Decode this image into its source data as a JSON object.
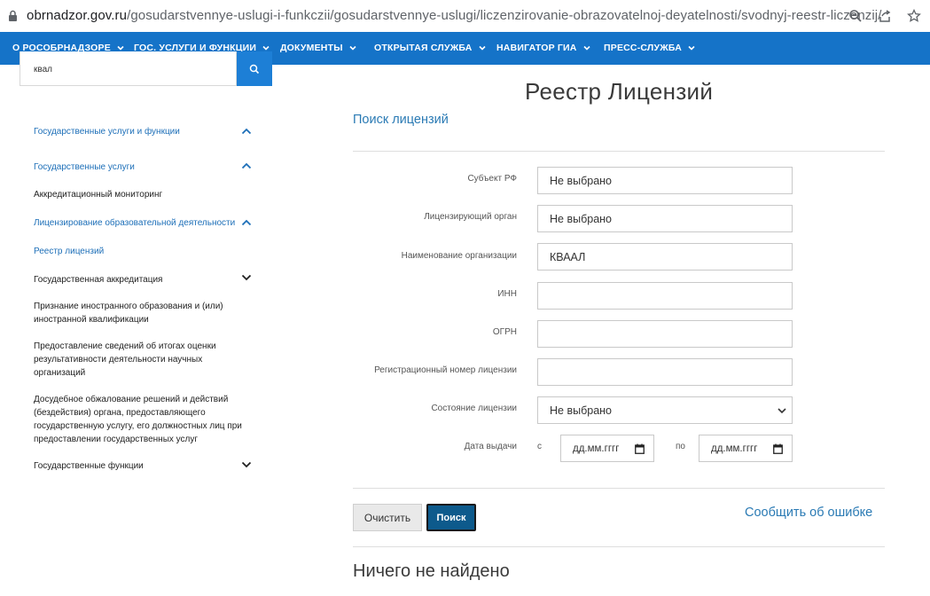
{
  "browser": {
    "url_host": "obrnadzor.gov.ru",
    "url_path": "/gosudarstvennye-uslugi-i-funkczii/gosudarstvennye-uslugi/liczenzirovanie-obrazovatelnoj-deyatelnosti/svodnyj-reestr-liczenzij/",
    "icons": [
      "lock-icon",
      "zoom-icon",
      "share-icon",
      "bookmark-star-icon"
    ]
  },
  "nav": {
    "items": [
      {
        "label": "О РОСОБРНАДЗОРЕ"
      },
      {
        "label": "ГОС. УСЛУГИ И ФУНКЦИИ"
      },
      {
        "label": "ДОКУМЕНТЫ"
      },
      {
        "label": "ОТКРЫТАЯ СЛУЖБА"
      },
      {
        "label": "НАВИГАТОР ГИА"
      },
      {
        "label": "ПРЕСС-СЛУЖБА"
      }
    ],
    "color": "#1573c8"
  },
  "search": {
    "value": "квал"
  },
  "sidebar": {
    "items": [
      {
        "label": "Государственные услуги и функции"
      },
      {
        "label": "Государственные услуги"
      },
      {
        "label": "Аккредитационный мониторинг"
      },
      {
        "label": "Лицензирование образовательной деятельности"
      },
      {
        "label": "Реестр лицензий"
      },
      {
        "label": "Государственная аккредитация"
      },
      {
        "label": "Признание иностранного образования и (или) иностранной квалификации"
      },
      {
        "label": "Предоставление сведений об итогах оценки результативности деятельности научных организаций"
      },
      {
        "label": "Досудебное обжалование решений и действий (бездействия) органа, предоставляющего государственную услугу, его должностных лиц при предоставлении государственных услуг"
      },
      {
        "label": "Государственные функции"
      }
    ]
  },
  "main": {
    "title": "Реестр Лицензий",
    "search_link": "Поиск лицензий",
    "form": {
      "subject_label": "Субъект РФ",
      "subject_value": "Не выбрано",
      "authority_label": "Лицензирующий орган",
      "authority_value": "Не выбрано",
      "org_label": "Наименование организации",
      "org_value": "КВААЛ",
      "inn_label": "ИНН",
      "inn_value": "",
      "ogrn_label": "ОГРН",
      "ogrn_value": "",
      "regnum_label": "Регистрационный номер лицензии",
      "regnum_value": "",
      "status_label": "Состояние лицензии",
      "status_value": "Не выбрано",
      "date_label": "Дата выдачи",
      "date_from_label": "с",
      "date_from_placeholder": "дд.мм.гггг",
      "date_to_label": "по",
      "date_to_placeholder": "дд.мм.гггг"
    },
    "clear_button": "Очистить",
    "search_button": "Поиск",
    "report_link": "Сообщить об ошибке",
    "result_text": "Ничего не найдено"
  }
}
